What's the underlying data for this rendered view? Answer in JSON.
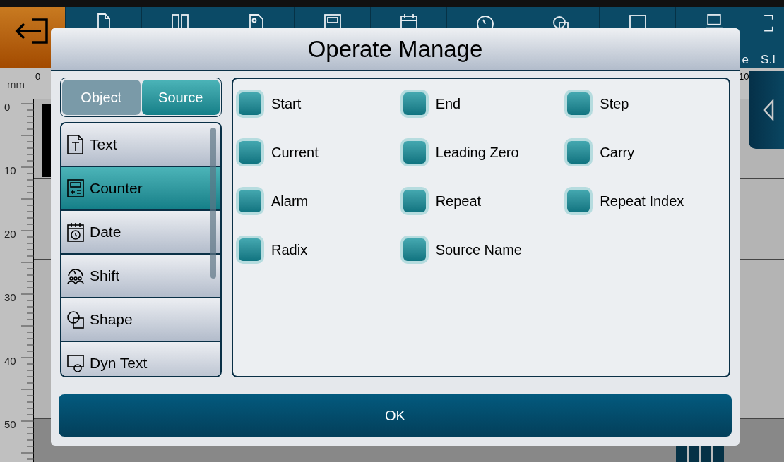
{
  "toolbar": {
    "labels": [
      "e",
      "S.I"
    ]
  },
  "ruler": {
    "unit": "mm",
    "top_ticks": [
      "0",
      "10"
    ],
    "left_ticks": [
      "0",
      "10",
      "20",
      "30",
      "40",
      "50"
    ]
  },
  "dialog": {
    "title": "Operate Manage",
    "tabs": [
      {
        "label": "Object",
        "selected": false
      },
      {
        "label": "Source",
        "selected": true
      }
    ],
    "objects": [
      {
        "label": "Text",
        "kind": "text",
        "selected": false
      },
      {
        "label": "Counter",
        "kind": "counter",
        "selected": true
      },
      {
        "label": "Date",
        "kind": "date",
        "selected": false
      },
      {
        "label": "Shift",
        "kind": "shift",
        "selected": false
      },
      {
        "label": "Shape",
        "kind": "shape",
        "selected": false
      },
      {
        "label": "Dyn Text",
        "kind": "dyntext",
        "selected": false
      }
    ],
    "options": [
      {
        "label": "Start",
        "checked": true
      },
      {
        "label": "End",
        "checked": true
      },
      {
        "label": "Step",
        "checked": true
      },
      {
        "label": "Current",
        "checked": true
      },
      {
        "label": "Leading Zero",
        "checked": true
      },
      {
        "label": "Carry",
        "checked": true
      },
      {
        "label": "Alarm",
        "checked": true
      },
      {
        "label": "Repeat",
        "checked": true
      },
      {
        "label": "Repeat Index",
        "checked": true
      },
      {
        "label": "Radix",
        "checked": true
      },
      {
        "label": "Source Name",
        "checked": true
      }
    ],
    "ok_button": "OK"
  }
}
